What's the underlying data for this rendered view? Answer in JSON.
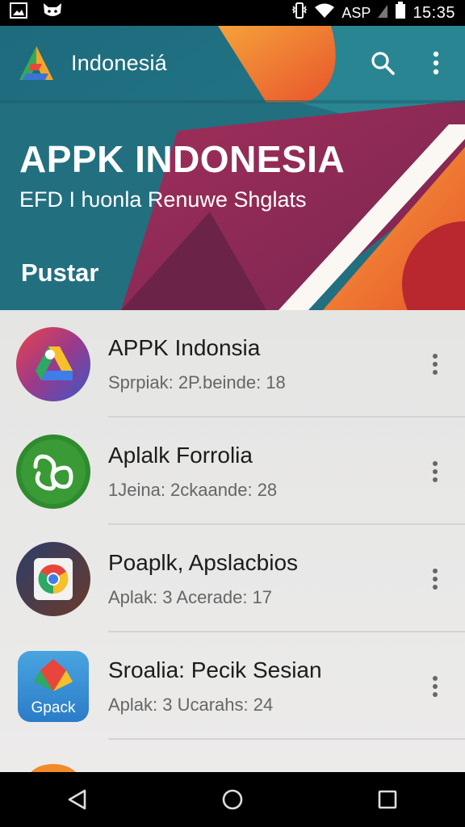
{
  "statusbar": {
    "carrier": "ASP",
    "time": "15:35",
    "icons": [
      "gallery-icon",
      "cat-icon",
      "vibrate-icon",
      "wifi-icon",
      "signal-icon",
      "battery-icon"
    ]
  },
  "appbar": {
    "title": "Indonesiá",
    "logo": "app-logo-icon",
    "actions": [
      "search-icon",
      "more-vert-icon"
    ]
  },
  "hero": {
    "title": "APPK INDONESIA",
    "subtitle": "EFD I ƕonla Renuwe Shglats",
    "cta": "Pustar"
  },
  "list": {
    "items": [
      {
        "title": "APPK Indonsia",
        "subtitle": "Sprpiak:  2P.beinde: 18",
        "icon": "drive-style-app-icon"
      },
      {
        "title": "Aplalk Forrolia",
        "subtitle": "1Jeina:  2ckaande: 28",
        "icon": "green-knot-app-icon"
      },
      {
        "title": "Poaplk, Apslacbios",
        "subtitle": "Aplak:  3 Acerade: 17",
        "icon": "chrome-style-app-icon"
      },
      {
        "title": "Sroalia: Pecik Sesian",
        "subtitle": "Aplak:  3 Ucarahs: 24",
        "icon": "gpack-app-icon",
        "icon_label": "Gpack"
      }
    ]
  },
  "navbar": {
    "buttons": [
      "back-icon",
      "home-icon",
      "recents-icon"
    ]
  },
  "colors": {
    "hero_teal": "#1f7080",
    "hero_magenta": "#8e2a55",
    "hero_orange": "#f07a2a",
    "statusbar": "#000000"
  }
}
